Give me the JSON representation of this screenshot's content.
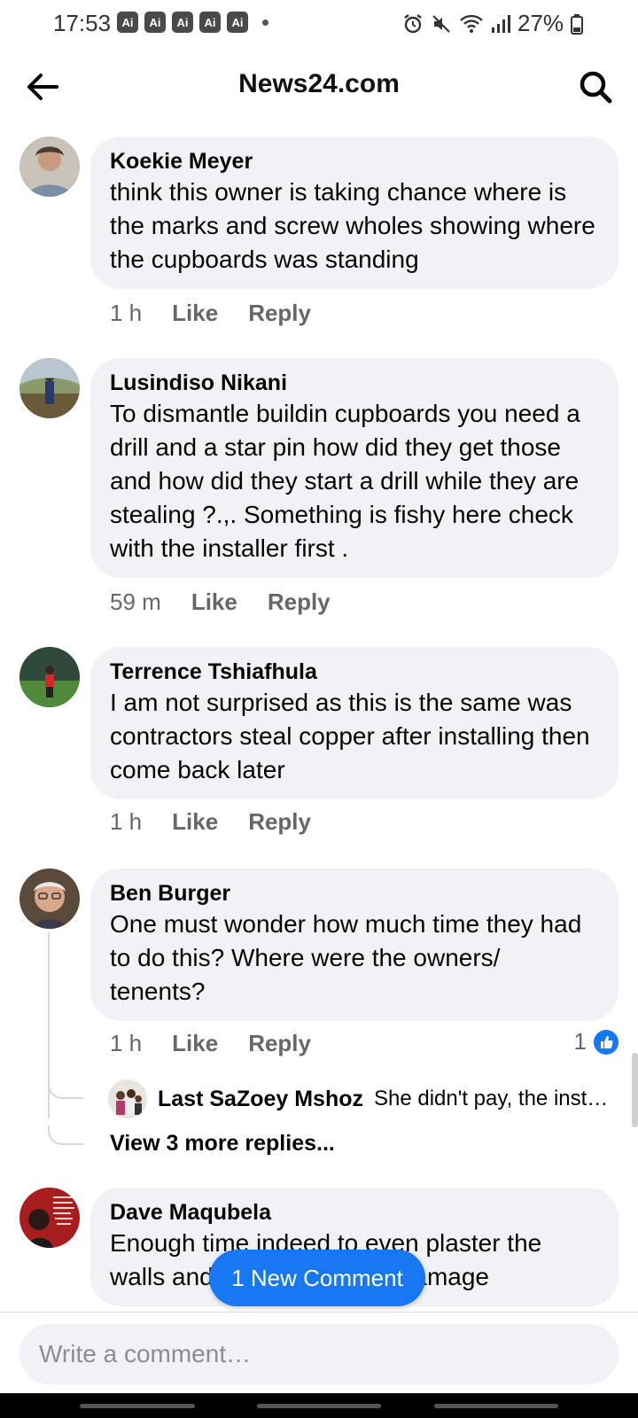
{
  "status_bar": {
    "time": "17:53",
    "ai_badges": [
      "Ai",
      "Ai",
      "Ai",
      "Ai",
      "Ai"
    ],
    "battery": "27%",
    "icons": [
      "alarm-icon",
      "mute-icon",
      "wifi-icon",
      "signal-icon",
      "battery-icon"
    ]
  },
  "header": {
    "title": "News24.com",
    "back_icon": "arrow-left-icon",
    "search_icon": "search-icon"
  },
  "comments": [
    {
      "author": "Koekie Meyer",
      "text": "think this owner is taking chance where is the marks and screw wholes showing where the cupboards was standing",
      "time": "1 h",
      "like_label": "Like",
      "reply_label": "Reply"
    },
    {
      "author": "Lusindiso Nikani",
      "text": "To dismantle buildin cupboards you need a drill and a star pin how did they get those and how did they start a drill while they are stealing ?.,. Something is fishy here check with the installer first .",
      "time": "59 m",
      "like_label": "Like",
      "reply_label": "Reply"
    },
    {
      "author": "Terrence Tshiafhula",
      "text": "I am not surprised as this is the same was contractors steal copper after installing then come back later",
      "time": "1 h",
      "like_label": "Like",
      "reply_label": "Reply"
    },
    {
      "author": "Ben Burger",
      "text": "One must wonder how much time they had to do this?   Where were the owners/ tenents?",
      "time": "1 h",
      "like_label": "Like",
      "reply_label": "Reply",
      "reaction_count": "1",
      "reply_preview": {
        "author": "Last SaZoey Mshoz",
        "text": "She didn't pay, the installers took it back"
      },
      "view_more": "View 3 more replies..."
    },
    {
      "author": "Dave Maqubela",
      "text": "Enough time indeed to even plaster the walls and repair structural damage"
    }
  ],
  "new_comment_pill": "1 New Comment",
  "composer": {
    "placeholder": "Write a comment…"
  },
  "colors": {
    "accent": "#1877f2",
    "bubble": "#f0f2f5",
    "secondary_text": "#65676b"
  }
}
